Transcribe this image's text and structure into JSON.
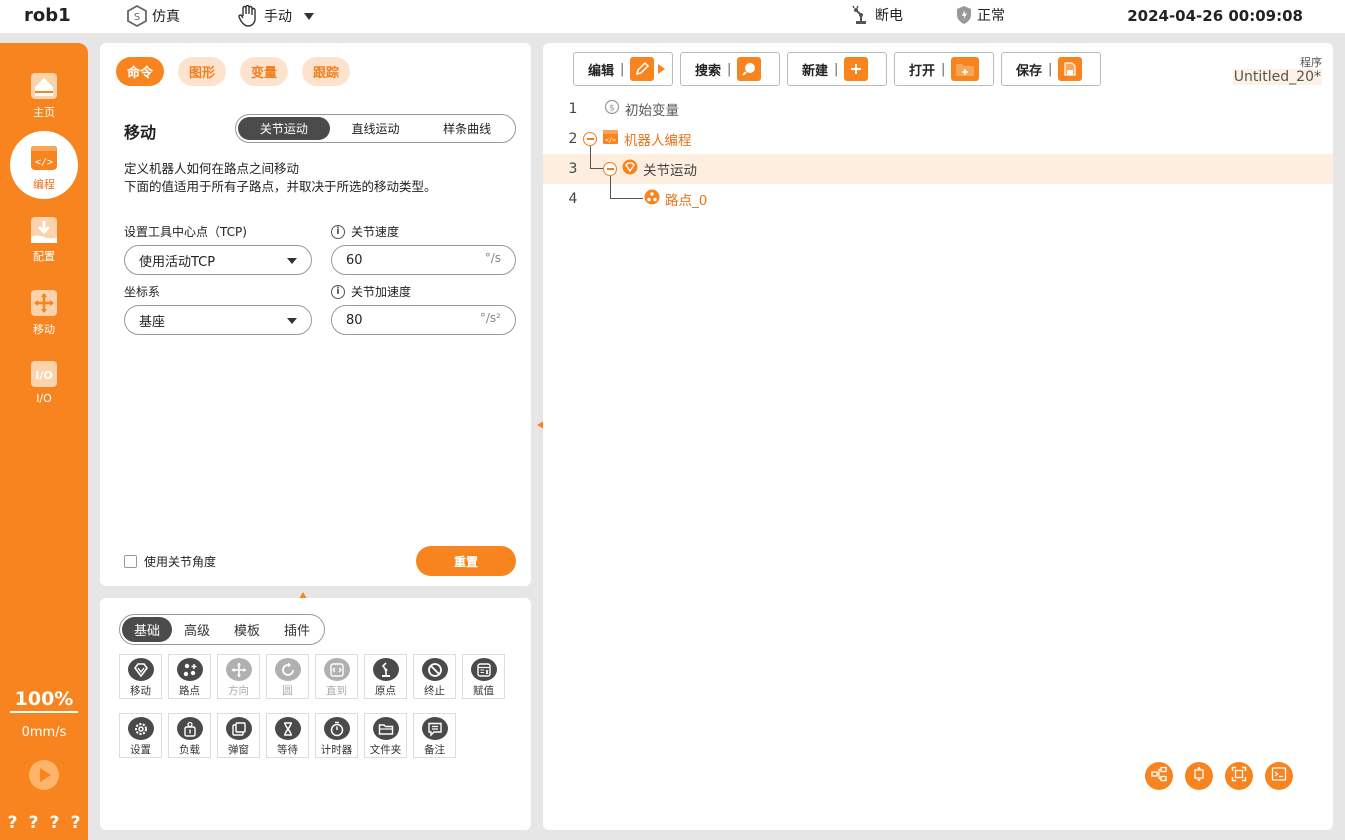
{
  "topbar": {
    "robot_name": "rob1",
    "mode_sim": "仿真",
    "mode_manual": "手动",
    "power_status": "断电",
    "safety_status": "正常",
    "datetime": "2024-04-26 00:09:08"
  },
  "sidebar": {
    "items": [
      {
        "label": "主页",
        "icon": "home-icon"
      },
      {
        "label": "编程",
        "icon": "code-icon",
        "active": true
      },
      {
        "label": "配置",
        "icon": "config-download-icon"
      },
      {
        "label": "移动",
        "icon": "move-arrows-icon"
      },
      {
        "label": "I/O",
        "icon": "io-icon"
      }
    ],
    "speed_percent": "100%",
    "speed_value": "0mm/s",
    "bottom_marks": [
      "?",
      "?",
      "?",
      "?"
    ]
  },
  "command_panel": {
    "tabs": [
      "命令",
      "图形",
      "变量",
      "跟踪"
    ],
    "active_tab": "命令",
    "section_title": "移动",
    "move_types": [
      "关节运动",
      "直线运动",
      "样条曲线"
    ],
    "active_move_type": "关节运动",
    "description_line1": "定义机器人如何在路点之间移动",
    "description_line2": "下面的值适用于所有子路点，并取决于所选的移动类型。",
    "tcp_label": "设置工具中心点（TCP)",
    "tcp_value": "使用活动TCP",
    "frame_label": "坐标系",
    "frame_value": "基座",
    "joint_speed_label": "关节速度",
    "joint_speed_value": "60",
    "joint_speed_unit": "°/s",
    "joint_accel_label": "关节加速度",
    "joint_accel_value": "80",
    "joint_accel_unit": "°/s²",
    "use_joint_angle_label": "使用关节角度",
    "use_joint_angle_checked": false,
    "reset_label": "重置"
  },
  "tool_panel": {
    "tabs": [
      "基础",
      "高级",
      "模板",
      "插件"
    ],
    "active_tab": "基础",
    "tools": [
      {
        "label": "移动",
        "icon": "move-icon",
        "enabled": true
      },
      {
        "label": "路点",
        "icon": "waypoint-icon",
        "enabled": true
      },
      {
        "label": "方向",
        "icon": "direction-icon",
        "enabled": false
      },
      {
        "label": "圆",
        "icon": "circle-icon",
        "enabled": false
      },
      {
        "label": "直到",
        "icon": "until-icon",
        "enabled": false
      },
      {
        "label": "原点",
        "icon": "home-position-icon",
        "enabled": true
      },
      {
        "label": "终止",
        "icon": "stop-icon",
        "enabled": true
      },
      {
        "label": "赋值",
        "icon": "assign-icon",
        "enabled": true
      },
      {
        "label": "设置",
        "icon": "settings-icon",
        "enabled": true
      },
      {
        "label": "负载",
        "icon": "payload-icon",
        "enabled": true
      },
      {
        "label": "弹窗",
        "icon": "popup-icon",
        "enabled": true
      },
      {
        "label": "等待",
        "icon": "wait-icon",
        "enabled": true
      },
      {
        "label": "计时器",
        "icon": "timer-icon",
        "enabled": true
      },
      {
        "label": "文件夹",
        "icon": "folder-icon",
        "enabled": true
      },
      {
        "label": "备注",
        "icon": "comment-icon",
        "enabled": true
      }
    ]
  },
  "program_panel": {
    "buttons": [
      {
        "label": "编辑",
        "sep": "|",
        "icon": "edit-icon"
      },
      {
        "label": "搜索",
        "sep": "|",
        "icon": "search-icon"
      },
      {
        "label": "新建",
        "sep": "|",
        "icon": "new-file-icon"
      },
      {
        "label": "打开",
        "sep": "|",
        "icon": "open-folder-icon"
      },
      {
        "label": "保存",
        "sep": "|",
        "icon": "save-icon"
      }
    ],
    "program_label": "程序",
    "program_name": "Untitled_20*",
    "tree": [
      {
        "line": "1",
        "label": "初始变量",
        "icon": "init-variables-icon"
      },
      {
        "line": "2",
        "label": "机器人编程",
        "icon": "robot-program-icon"
      },
      {
        "line": "3",
        "label": "关节运动",
        "icon": "move-node-icon",
        "selected": true
      },
      {
        "line": "4",
        "label": "路点_0",
        "icon": "waypoint-node-icon"
      }
    ],
    "fab_icons": [
      "tree-structure-icon",
      "expand-vertical-icon",
      "fit-screen-icon",
      "console-icon"
    ]
  },
  "colors": {
    "accent": "#f7841e",
    "accent_light": "#fde3cd",
    "dark_segment": "#4b4b4b",
    "selected_row": "#fdeee0"
  }
}
